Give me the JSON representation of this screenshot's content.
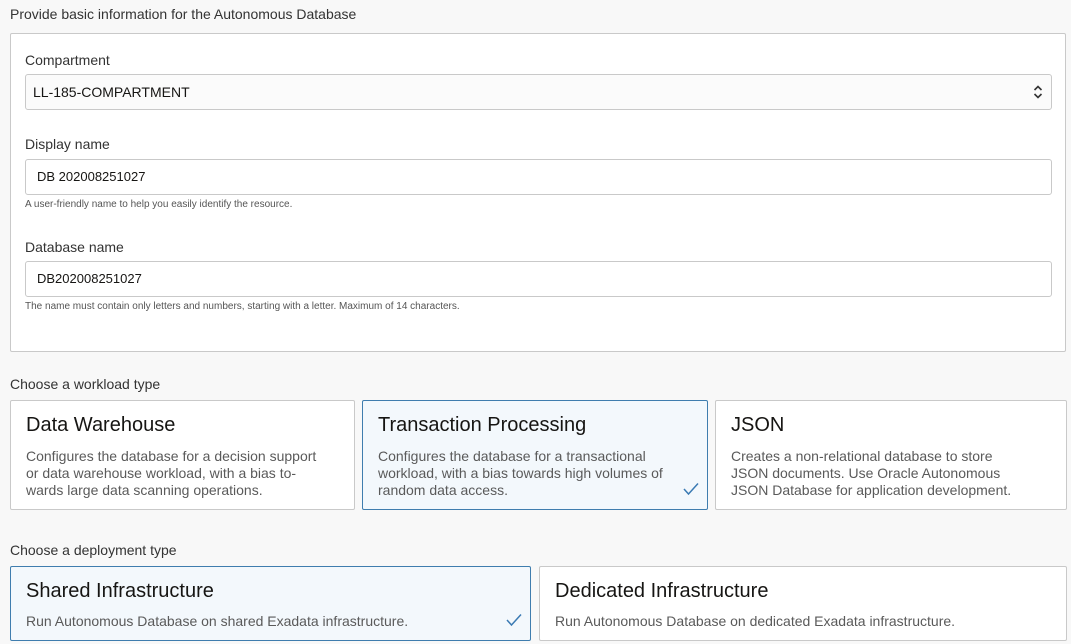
{
  "basic_section": {
    "title": "Provide basic information for the Autonomous Database",
    "compartment": {
      "label": "Compartment",
      "value": "LL-185-COMPARTMENT"
    },
    "display_name": {
      "label": "Display name",
      "value": "DB 202008251027",
      "help": "A user-friendly name to help you easily identify the resource."
    },
    "database_name": {
      "label": "Database name",
      "value": "DB202008251027",
      "help": "The name must contain only letters and numbers, starting with a letter. Maximum of 14 characters."
    }
  },
  "workload": {
    "title": "Choose a workload type",
    "options": [
      {
        "title": "Data Warehouse",
        "lines": [
          "Configures the database for a decision support",
          "or data warehouse workload, with a bias to-",
          "wards large data scanning operations."
        ],
        "selected": false
      },
      {
        "title": "Transaction Processing",
        "lines": [
          "Configures the database for a transactional",
          "workload, with a bias towards high volumes of",
          "random data access."
        ],
        "selected": true
      },
      {
        "title": "JSON",
        "lines": [
          "Creates a non-relational database to store",
          "JSON documents. Use Oracle Autonomous",
          "JSON Database for application development."
        ],
        "selected": false
      }
    ]
  },
  "deployment": {
    "title": "Choose a deployment type",
    "options": [
      {
        "title": "Shared Infrastructure",
        "description": "Run Autonomous Database on shared Exadata infrastructure.",
        "selected": true
      },
      {
        "title": "Dedicated Infrastructure",
        "description": "Run Autonomous Database on dedicated Exadata infrastructure.",
        "selected": false
      }
    ]
  },
  "colors": {
    "selected_border": "#3f7dae",
    "selected_bg": "#f3f8fc",
    "check": "#3a7ab3"
  },
  "icons": {
    "select": "chevron-up-down-icon",
    "selected_marker": "check-icon"
  }
}
